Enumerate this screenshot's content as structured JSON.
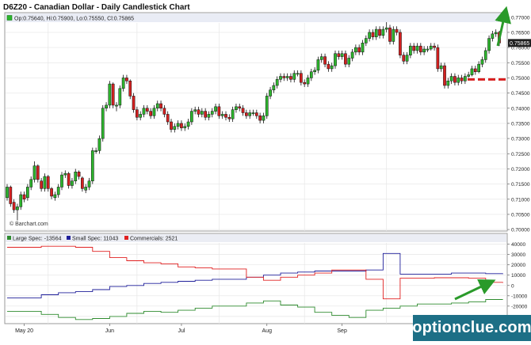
{
  "title": "D6Z20 - Canadian Dollar - Daily Candlestick Chart",
  "ohlc_readout": "Op:0.75640, Hi:0.75900, Lo:0.75550, Cl:0.75865",
  "last_price_tag": "0.75865",
  "credit": "© Barchart.com",
  "watermark": "optionclue.com",
  "colors": {
    "up_candle": "#2db52d",
    "down_candle": "#d42020",
    "large_spec": "#2e8b2e",
    "small_spec": "#1f1f9a",
    "commercials": "#e02020",
    "arrow": "#2a9a2a",
    "support_line": "#d81f1f",
    "background": "#ffffff",
    "grid": "#e6e6e6",
    "watermark_bg": "#1d6f86"
  },
  "price_axis": {
    "ticks": [
      "0.77000",
      "0.76500",
      "0.76000",
      "0.75500",
      "0.75000",
      "0.74500",
      "0.74000",
      "0.73500",
      "0.73000",
      "0.72500",
      "0.72000",
      "0.71500",
      "0.71000",
      "0.70500",
      "0.70000"
    ]
  },
  "cot_axis": {
    "ticks": [
      "40000",
      "30000",
      "20000",
      "10000",
      "0",
      "-10000",
      "-20000",
      "-30000"
    ]
  },
  "x_axis": {
    "ticks": [
      "May 20",
      "Jun",
      "Jul",
      "Aug",
      "Sep"
    ]
  },
  "cot_legend": [
    {
      "key": "large",
      "label": "Large Spec: -13564"
    },
    {
      "key": "small",
      "label": "Small Spec: 11043"
    },
    {
      "key": "comm",
      "label": "Commercials: 2521"
    }
  ],
  "chart_data": [
    {
      "type": "candlestick",
      "title": "D6Z20 - Canadian Dollar - Daily Candlestick Chart",
      "ylim": [
        0.7,
        0.77
      ],
      "x_ticks": [
        "May 20",
        "Jun",
        "Jul",
        "Aug",
        "Sep"
      ],
      "annotations": [
        "upward arrow near last bars",
        "dashed support line at 0.7495"
      ],
      "x": [
        1,
        2,
        3,
        4,
        5,
        6,
        7,
        8,
        9,
        10,
        11,
        12,
        13,
        14,
        15,
        16,
        17,
        18,
        19,
        20,
        21,
        22,
        23,
        24,
        25,
        26,
        27,
        28,
        29,
        30,
        31,
        32,
        33,
        34,
        35,
        36,
        37,
        38,
        39,
        40,
        41,
        42,
        43,
        44,
        45,
        46,
        47,
        48,
        49,
        50,
        51,
        52,
        53,
        54,
        55,
        56,
        57,
        58,
        59,
        60,
        61,
        62,
        63,
        64,
        65,
        66,
        67,
        68,
        69,
        70,
        71,
        72,
        73,
        74,
        75,
        76,
        77,
        78,
        79,
        80,
        81,
        82,
        83,
        84,
        85,
        86,
        87,
        88,
        89,
        90,
        91,
        92,
        93,
        94,
        95,
        96,
        97,
        98,
        99,
        100,
        101,
        102,
        103,
        104,
        105,
        106,
        107,
        108,
        109,
        110,
        111,
        112,
        113,
        114,
        115,
        116,
        117,
        118,
        119,
        120,
        121,
        122,
        123,
        124,
        125,
        126,
        127,
        128,
        129,
        130,
        131,
        132,
        133,
        134,
        135,
        136,
        137,
        138,
        139,
        140,
        141,
        142,
        143,
        144,
        145
      ],
      "open": [
        0.7105,
        0.714,
        0.709,
        0.7065,
        0.7075,
        0.7115,
        0.7105,
        0.714,
        0.7165,
        0.721,
        0.716,
        0.7135,
        0.7175,
        0.7135,
        0.7105,
        0.7115,
        0.714,
        0.718,
        0.7185,
        0.7145,
        0.716,
        0.719,
        0.717,
        0.713,
        0.714,
        0.716,
        0.726,
        0.726,
        0.73,
        0.74,
        0.741,
        0.748,
        0.741,
        0.741,
        0.7465,
        0.75,
        0.749,
        0.744,
        0.7395,
        0.737,
        0.738,
        0.74,
        0.739,
        0.7375,
        0.74,
        0.7415,
        0.74,
        0.738,
        0.7355,
        0.733,
        0.734,
        0.735,
        0.7335,
        0.734,
        0.7355,
        0.739,
        0.7395,
        0.738,
        0.739,
        0.737,
        0.738,
        0.739,
        0.7405,
        0.7375,
        0.738,
        0.737,
        0.7365,
        0.7395,
        0.7405,
        0.74,
        0.7385,
        0.7375,
        0.7385,
        0.7385,
        0.7375,
        0.736,
        0.7375,
        0.744,
        0.746,
        0.7475,
        0.7495,
        0.7505,
        0.75,
        0.7505,
        0.7495,
        0.7515,
        0.7515,
        0.7485,
        0.748,
        0.75,
        0.752,
        0.7525,
        0.756,
        0.757,
        0.7545,
        0.753,
        0.754,
        0.758,
        0.757,
        0.758,
        0.7545,
        0.7565,
        0.7585,
        0.76,
        0.7585,
        0.7615,
        0.763,
        0.765,
        0.7635,
        0.766,
        0.764,
        0.766,
        0.7665,
        0.762,
        0.766,
        0.765,
        0.7575,
        0.7555,
        0.7575,
        0.7605,
        0.759,
        0.7605,
        0.7585,
        0.7595,
        0.7595,
        0.7605,
        0.76,
        0.753,
        0.754,
        0.7475,
        0.749,
        0.7505,
        0.7485,
        0.75,
        0.749,
        0.7505,
        0.751,
        0.753,
        0.752,
        0.7545,
        0.756,
        0.759,
        0.763,
        0.7645,
        0.765,
        0.7615,
        0.759
      ],
      "close": [
        0.714,
        0.7085,
        0.7065,
        0.7075,
        0.7115,
        0.71,
        0.714,
        0.7165,
        0.721,
        0.7165,
        0.7135,
        0.7175,
        0.7135,
        0.711,
        0.7115,
        0.714,
        0.718,
        0.7185,
        0.7145,
        0.716,
        0.719,
        0.7175,
        0.7135,
        0.714,
        0.716,
        0.726,
        0.726,
        0.73,
        0.74,
        0.741,
        0.748,
        0.741,
        0.741,
        0.7465,
        0.75,
        0.749,
        0.744,
        0.7395,
        0.737,
        0.738,
        0.74,
        0.739,
        0.7375,
        0.74,
        0.7415,
        0.74,
        0.738,
        0.7355,
        0.733,
        0.734,
        0.735,
        0.7335,
        0.734,
        0.7355,
        0.739,
        0.7395,
        0.738,
        0.739,
        0.737,
        0.738,
        0.739,
        0.7405,
        0.7375,
        0.738,
        0.737,
        0.7365,
        0.7395,
        0.7405,
        0.74,
        0.7385,
        0.7375,
        0.7385,
        0.7385,
        0.7375,
        0.736,
        0.7375,
        0.744,
        0.746,
        0.7475,
        0.7495,
        0.7505,
        0.75,
        0.7505,
        0.7495,
        0.7515,
        0.7515,
        0.7485,
        0.748,
        0.75,
        0.752,
        0.7525,
        0.756,
        0.757,
        0.7545,
        0.753,
        0.754,
        0.758,
        0.757,
        0.758,
        0.7545,
        0.7565,
        0.7585,
        0.76,
        0.7585,
        0.7615,
        0.763,
        0.765,
        0.7635,
        0.766,
        0.764,
        0.766,
        0.7665,
        0.762,
        0.766,
        0.765,
        0.7575,
        0.7555,
        0.7575,
        0.7605,
        0.759,
        0.7605,
        0.7585,
        0.7595,
        0.7595,
        0.7605,
        0.76,
        0.753,
        0.754,
        0.7475,
        0.749,
        0.7505,
        0.7485,
        0.75,
        0.749,
        0.7505,
        0.751,
        0.753,
        0.752,
        0.7545,
        0.756,
        0.759,
        0.763,
        0.7645,
        0.765,
        0.7615,
        0.759,
        0.7587
      ],
      "high": [
        0.715,
        0.7145,
        0.71,
        0.7085,
        0.7125,
        0.7125,
        0.715,
        0.7175,
        0.7225,
        0.7215,
        0.717,
        0.7185,
        0.718,
        0.714,
        0.7125,
        0.715,
        0.719,
        0.7195,
        0.719,
        0.717,
        0.72,
        0.7195,
        0.7175,
        0.715,
        0.717,
        0.727,
        0.727,
        0.731,
        0.741,
        0.742,
        0.749,
        0.7485,
        0.742,
        0.7475,
        0.751,
        0.751,
        0.7495,
        0.745,
        0.7405,
        0.739,
        0.741,
        0.741,
        0.74,
        0.741,
        0.7425,
        0.7425,
        0.741,
        0.739,
        0.7365,
        0.735,
        0.736,
        0.736,
        0.735,
        0.7365,
        0.74,
        0.7405,
        0.7405,
        0.74,
        0.74,
        0.739,
        0.74,
        0.7415,
        0.7415,
        0.739,
        0.739,
        0.738,
        0.7405,
        0.7415,
        0.7415,
        0.741,
        0.7395,
        0.7395,
        0.7395,
        0.7395,
        0.7385,
        0.7385,
        0.745,
        0.747,
        0.7485,
        0.7505,
        0.7515,
        0.7515,
        0.7515,
        0.7515,
        0.7525,
        0.7525,
        0.7525,
        0.7495,
        0.751,
        0.753,
        0.7535,
        0.757,
        0.758,
        0.758,
        0.7555,
        0.755,
        0.759,
        0.759,
        0.759,
        0.759,
        0.7575,
        0.7595,
        0.761,
        0.761,
        0.7625,
        0.764,
        0.766,
        0.766,
        0.767,
        0.767,
        0.767,
        0.77,
        0.7675,
        0.767,
        0.767,
        0.766,
        0.7585,
        0.7585,
        0.7615,
        0.7615,
        0.7615,
        0.7615,
        0.7605,
        0.7605,
        0.7615,
        0.7615,
        0.761,
        0.755,
        0.755,
        0.75,
        0.7515,
        0.7515,
        0.751,
        0.751,
        0.7515,
        0.752,
        0.754,
        0.754,
        0.7555,
        0.757,
        0.76,
        0.764,
        0.7655,
        0.766,
        0.7655,
        0.7625,
        0.76
      ],
      "low": [
        0.7095,
        0.7075,
        0.7055,
        0.703,
        0.7065,
        0.709,
        0.7095,
        0.713,
        0.7155,
        0.7155,
        0.7125,
        0.7125,
        0.7125,
        0.71,
        0.7095,
        0.7105,
        0.713,
        0.717,
        0.7135,
        0.7135,
        0.715,
        0.7165,
        0.7125,
        0.712,
        0.713,
        0.715,
        0.725,
        0.725,
        0.729,
        0.739,
        0.74,
        0.74,
        0.739,
        0.74,
        0.7455,
        0.748,
        0.743,
        0.7385,
        0.736,
        0.736,
        0.737,
        0.738,
        0.7365,
        0.7365,
        0.739,
        0.739,
        0.737,
        0.7345,
        0.732,
        0.732,
        0.733,
        0.7325,
        0.7325,
        0.733,
        0.7345,
        0.738,
        0.737,
        0.737,
        0.736,
        0.736,
        0.737,
        0.738,
        0.7365,
        0.7365,
        0.736,
        0.7355,
        0.7355,
        0.7385,
        0.739,
        0.7375,
        0.7365,
        0.7365,
        0.7375,
        0.7365,
        0.735,
        0.735,
        0.7365,
        0.743,
        0.745,
        0.7465,
        0.7485,
        0.749,
        0.749,
        0.7485,
        0.7485,
        0.7505,
        0.7475,
        0.747,
        0.747,
        0.749,
        0.751,
        0.7515,
        0.755,
        0.7535,
        0.752,
        0.752,
        0.753,
        0.756,
        0.756,
        0.7535,
        0.7535,
        0.7555,
        0.7575,
        0.7575,
        0.7575,
        0.7605,
        0.762,
        0.7625,
        0.7625,
        0.763,
        0.763,
        0.765,
        0.761,
        0.761,
        0.764,
        0.7565,
        0.7545,
        0.7545,
        0.7565,
        0.758,
        0.758,
        0.7575,
        0.7575,
        0.7585,
        0.759,
        0.759,
        0.752,
        0.752,
        0.7465,
        0.7465,
        0.748,
        0.7475,
        0.7475,
        0.748,
        0.748,
        0.75,
        0.7505,
        0.751,
        0.7515,
        0.7535,
        0.755,
        0.758,
        0.762,
        0.7635,
        0.7605,
        0.758,
        0.7555
      ]
    },
    {
      "type": "line",
      "title": "",
      "ylim": [
        -37000,
        42000
      ],
      "x_ticks": [
        "May 20",
        "Jun",
        "Jul",
        "Aug",
        "Sep"
      ],
      "series": [
        {
          "name": "Large Spec",
          "x": [
            0,
            5,
            10,
            15,
            20,
            25,
            30,
            35,
            40,
            45,
            50,
            55,
            60,
            65,
            70,
            75,
            80,
            85,
            90,
            95,
            100,
            105,
            110,
            115,
            120,
            125,
            130,
            135,
            140,
            145
          ],
          "values": [
            -25000,
            -25000,
            -28000,
            -31000,
            -33000,
            -32000,
            -30000,
            -27000,
            -25000,
            -26000,
            -24000,
            -22000,
            -20000,
            -20000,
            -17000,
            -15000,
            -19000,
            -21000,
            -26000,
            -29000,
            -31000,
            -24000,
            -22000,
            -20000,
            -18000,
            -18000,
            -17000,
            -16000,
            -13600,
            -13564
          ]
        },
        {
          "name": "Small Spec",
          "x": [
            0,
            5,
            10,
            15,
            20,
            25,
            30,
            35,
            40,
            45,
            50,
            55,
            60,
            65,
            70,
            75,
            80,
            85,
            90,
            95,
            100,
            105,
            110,
            115,
            120,
            125,
            130,
            135,
            140,
            145
          ],
          "values": [
            -12000,
            -12000,
            -9000,
            -7000,
            -6000,
            -4000,
            -1000,
            0,
            2000,
            3000,
            4000,
            5000,
            6000,
            6000,
            8000,
            10000,
            12000,
            13000,
            14000,
            14000,
            14000,
            15000,
            31000,
            11000,
            11000,
            11000,
            12000,
            12000,
            11500,
            11043
          ]
        },
        {
          "name": "Commercials",
          "x": [
            0,
            5,
            10,
            15,
            20,
            25,
            30,
            35,
            40,
            45,
            50,
            55,
            60,
            65,
            70,
            75,
            80,
            85,
            90,
            95,
            100,
            105,
            110,
            115,
            120,
            125,
            130,
            135,
            140,
            145
          ],
          "values": [
            37000,
            37000,
            38000,
            38000,
            37000,
            33000,
            27000,
            24000,
            22000,
            21000,
            18000,
            17000,
            16000,
            16000,
            8000,
            5000,
            8000,
            10000,
            12000,
            15000,
            15000,
            6000,
            -13000,
            7000,
            7000,
            7500,
            7500,
            7000,
            3000,
            2521
          ]
        }
      ]
    }
  ]
}
